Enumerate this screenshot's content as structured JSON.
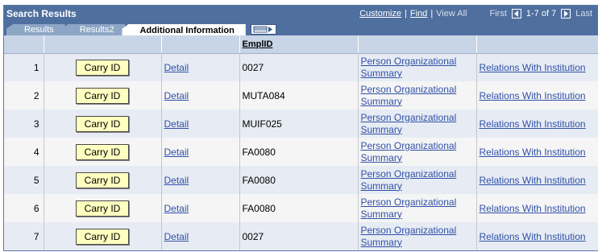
{
  "title": "Search Results",
  "nav": {
    "customize": "Customize",
    "separator": "|",
    "find": "Find",
    "view_all": "View All",
    "first": "First",
    "range": "1-7 of 7",
    "last": "Last"
  },
  "tabs": [
    {
      "label": "Results"
    },
    {
      "label": "Results2"
    },
    {
      "label": "Additional Information"
    }
  ],
  "columns": [
    "",
    "",
    "",
    "EmplID",
    "",
    ""
  ],
  "rows": [
    {
      "num": "1",
      "button": "Carry ID",
      "detail": "Detail",
      "emplid": "0027",
      "person": "Person Organizational Summary",
      "relations": "Relations With Institution"
    },
    {
      "num": "2",
      "button": "Carry ID",
      "detail": "Detail",
      "emplid": "MUTA084",
      "person": "Person Organizational Summary",
      "relations": "Relations With Institution"
    },
    {
      "num": "3",
      "button": "Carry ID",
      "detail": "Detail",
      "emplid": "MUIF025",
      "person": "Person Organizational Summary",
      "relations": "Relations With Institution"
    },
    {
      "num": "4",
      "button": "Carry ID",
      "detail": "Detail",
      "emplid": "FA0080",
      "person": "Person Organizational Summary",
      "relations": "Relations With Institution"
    },
    {
      "num": "5",
      "button": "Carry ID",
      "detail": "Detail",
      "emplid": "FA0080",
      "person": "Person Organizational Summary",
      "relations": "Relations With Institution"
    },
    {
      "num": "6",
      "button": "Carry ID",
      "detail": "Detail",
      "emplid": "FA0080",
      "person": "Person Organizational Summary",
      "relations": "Relations With Institution"
    },
    {
      "num": "7",
      "button": "Carry ID",
      "detail": "Detail",
      "emplid": "0027",
      "person": "Person Organizational Summary",
      "relations": "Relations With Institution"
    }
  ],
  "icons": {
    "tab_icon": "show-all-columns-icon",
    "first_arrow": "arrow-left-icon",
    "last_arrow": "arrow-right-icon"
  },
  "colors": {
    "header_bg": "#4f6f9f",
    "button_bg": "#ffffc0",
    "link": "#3050a8"
  }
}
